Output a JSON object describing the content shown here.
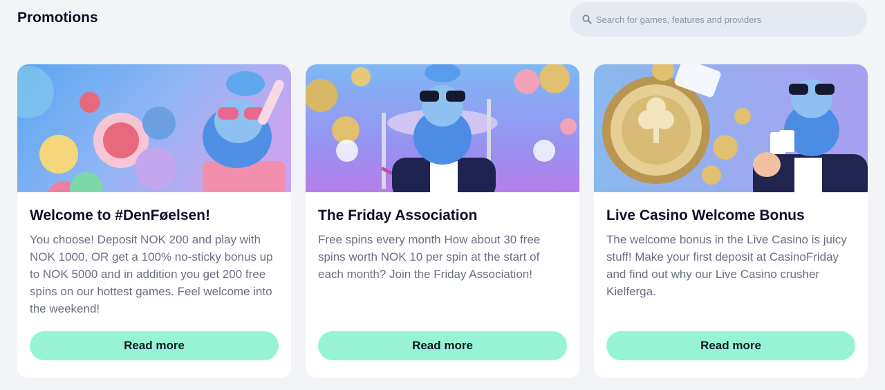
{
  "header": {
    "title": "Promotions"
  },
  "search": {
    "placeholder": "Search for games, features and providers",
    "icon": "search-icon"
  },
  "cards": [
    {
      "image_label": "Bearded mascot in pink sunglasses with casino chips",
      "title": "Welcome to #DenFøelsen!",
      "description": "You choose! Deposit NOK 200 and play with NOK 1000, OR get a 100% no-sticky bonus up to NOK 5000 and in addition you get 200 free spins on our hottest games. Feel welcome into the weekend!",
      "button_label": "Read more"
    },
    {
      "image_label": "Bearded mascot in tuxedo with gold coins",
      "title": "The Friday Association",
      "description": "Free spins every month How about 30 free spins worth NOK 10 per spin at the start of each month? Join the Friday Association!",
      "button_label": "Read more"
    },
    {
      "image_label": "Live Casino welcome offer chip with mascot holding cards",
      "title": "Live Casino Welcome Bonus",
      "description": "The welcome bonus in the Live Casino is juicy stuff! Make your first deposit at CasinoFriday and find out why our Live Casino crusher Kielferga.",
      "button_label": "Read more"
    }
  ],
  "colors": {
    "background": "#f2f4f8",
    "button": "#96f4d5",
    "text_dark": "#0d0f26",
    "text_muted": "#6a7084"
  }
}
